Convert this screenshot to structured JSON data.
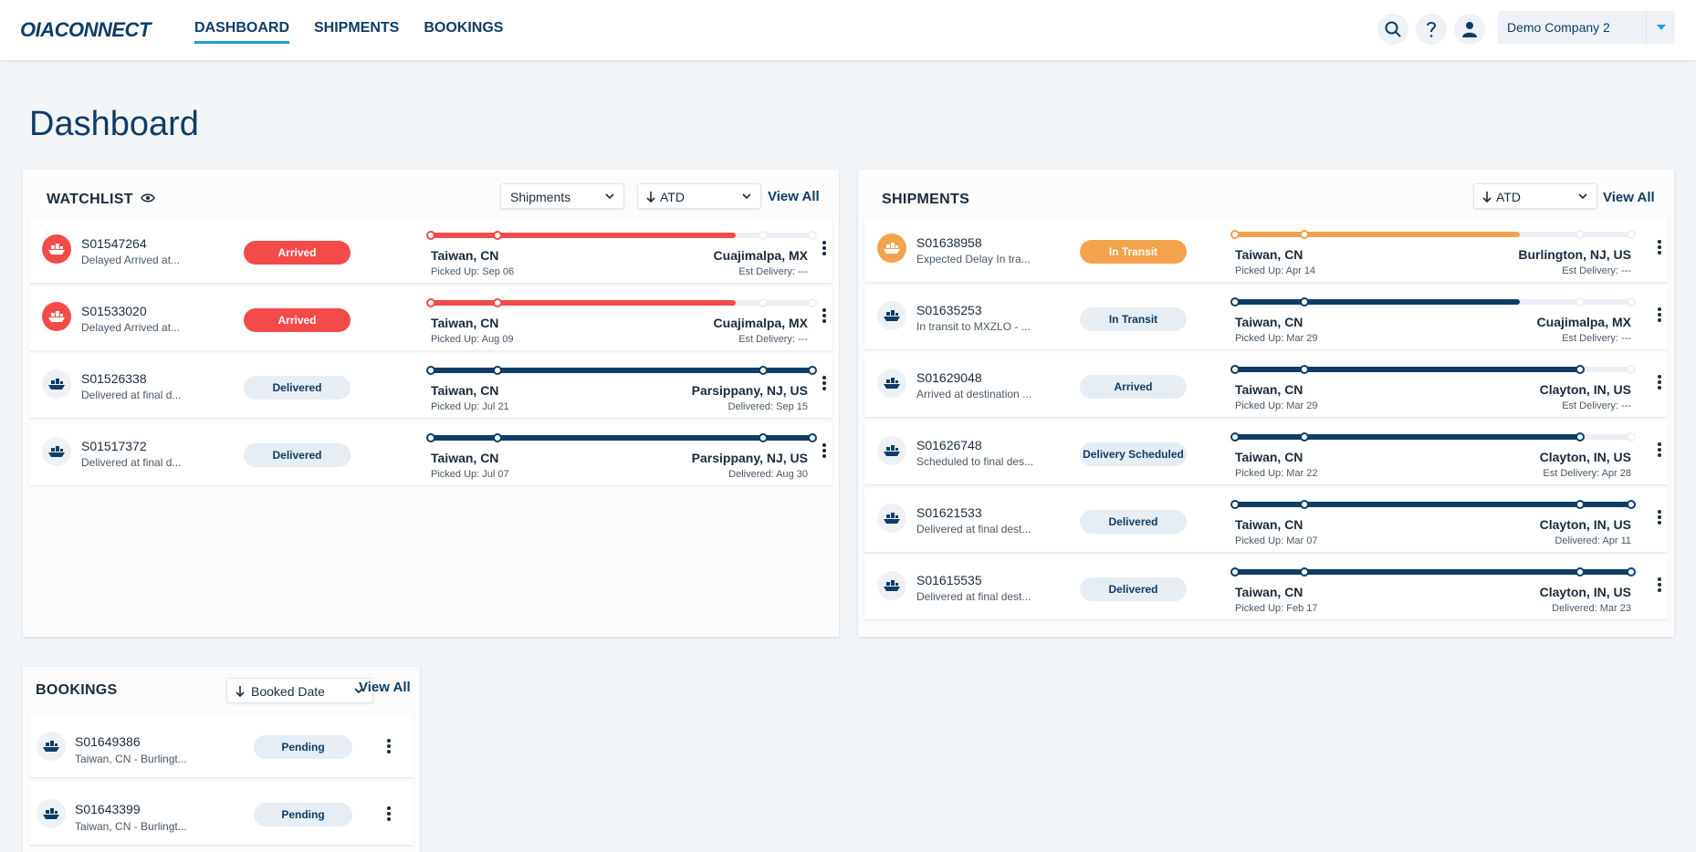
{
  "brand": {
    "logo_text": "OIACONNECT",
    "accent": "#1ba0d8",
    "primary": "#0f3d66"
  },
  "nav": {
    "dashboard": "DASHBOARD",
    "shipments": "SHIPMENTS",
    "bookings": "BOOKINGS"
  },
  "header": {
    "company": "Demo Company 2"
  },
  "page": {
    "title": "Dashboard"
  },
  "watchlist": {
    "title": "WATCHLIST",
    "type_select": "Shipments",
    "sort_select": "ATD",
    "view_all": "View All",
    "rows": [
      {
        "id": "S01547264",
        "desc": "Delayed Arrived at...",
        "status": "Arrived",
        "status_style": "red",
        "origin": "Taiwan, CN",
        "dest": "Cuajimalpa, MX",
        "picked": "Picked Up: Sep 06",
        "delivery": "Est Delivery: ---",
        "progress": 0.8
      },
      {
        "id": "S01533020",
        "desc": "Delayed Arrived at...",
        "status": "Arrived",
        "status_style": "red",
        "origin": "Taiwan, CN",
        "dest": "Cuajimalpa, MX",
        "picked": "Picked Up: Aug 09",
        "delivery": "Est Delivery: ---",
        "progress": 0.8
      },
      {
        "id": "S01526338",
        "desc": "Delivered at final d...",
        "status": "Delivered",
        "status_style": "grey",
        "origin": "Taiwan, CN",
        "dest": "Parsippany, NJ, US",
        "picked": "Picked Up: Jul 21",
        "delivery": "Delivered: Sep 15",
        "progress": 1.0
      },
      {
        "id": "S01517372",
        "desc": "Delivered at final d...",
        "status": "Delivered",
        "status_style": "grey",
        "origin": "Taiwan, CN",
        "dest": "Parsippany, NJ, US",
        "picked": "Picked Up: Jul 07",
        "delivery": "Delivered: Aug 30",
        "progress": 1.0
      }
    ]
  },
  "shipments": {
    "title": "SHIPMENTS",
    "sort_select": "ATD",
    "view_all": "View All",
    "rows": [
      {
        "id": "S01638958",
        "desc": "Expected Delay In tra...",
        "status": "In Transit",
        "status_style": "orange",
        "origin": "Taiwan, CN",
        "dest": "Burlington, NJ, US",
        "picked": "Picked Up: Apr 14",
        "delivery": "Est Delivery: ---",
        "progress": 0.72
      },
      {
        "id": "S01635253",
        "desc": "In transit to MXZLO - ...",
        "status": "In Transit",
        "status_style": "grey",
        "origin": "Taiwan, CN",
        "dest": "Cuajimalpa, MX",
        "picked": "Picked Up: Mar 29",
        "delivery": "Est Delivery: ---",
        "progress": 0.72
      },
      {
        "id": "S01629048",
        "desc": "Arrived at destination ...",
        "status": "Arrived",
        "status_style": "grey",
        "origin": "Taiwan, CN",
        "dest": "Clayton, IN, US",
        "picked": "Picked Up: Mar 29",
        "delivery": "Est Delivery: ---",
        "progress": 0.87
      },
      {
        "id": "S01626748",
        "desc": "Scheduled to final des...",
        "status": "Delivery Scheduled",
        "status_style": "grey",
        "origin": "Taiwan, CN",
        "dest": "Clayton, IN, US",
        "picked": "Picked Up: Mar 22",
        "delivery": "Est Delivery: Apr 28",
        "progress": 0.87
      },
      {
        "id": "S01621533",
        "desc": "Delivered at final dest...",
        "status": "Delivered",
        "status_style": "grey",
        "origin": "Taiwan, CN",
        "dest": "Clayton, IN, US",
        "picked": "Picked Up: Mar 07",
        "delivery": "Delivered: Apr 11",
        "progress": 1.0
      },
      {
        "id": "S01615535",
        "desc": "Delivered at final dest...",
        "status": "Delivered",
        "status_style": "grey",
        "origin": "Taiwan, CN",
        "dest": "Clayton, IN, US",
        "picked": "Picked Up: Feb 17",
        "delivery": "Delivered: Mar 23",
        "progress": 1.0
      }
    ]
  },
  "bookings": {
    "title": "BOOKINGS",
    "sort_select": "Booked Date",
    "view_all": "View All",
    "rows": [
      {
        "id": "S01649386",
        "desc": "Taiwan, CN - Burlingt...",
        "status": "Pending"
      },
      {
        "id": "S01643399",
        "desc": "Taiwan, CN - Burlingt...",
        "status": "Pending"
      }
    ]
  }
}
